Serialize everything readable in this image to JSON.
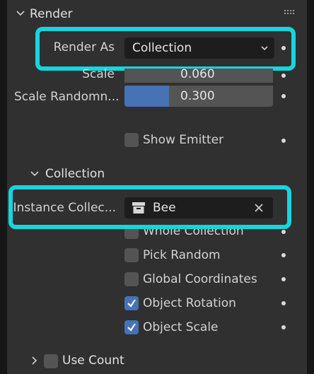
{
  "render_panel": {
    "title": "Render",
    "render_as": {
      "label": "Render As",
      "value": "Collection"
    },
    "scale": {
      "label": "Scale",
      "value": "0.060"
    },
    "scale_randomness": {
      "label": "Scale Randomn...",
      "value": "0.300",
      "fill_fraction": 0.3
    },
    "show_emitter": {
      "label": "Show Emitter",
      "checked": false
    }
  },
  "collection_panel": {
    "title": "Collection",
    "instance_collection": {
      "label": "Instance Collec...",
      "value": "Bee"
    },
    "whole_collection": {
      "label": "Whole Collection",
      "checked": false
    },
    "pick_random": {
      "label": "Pick Random",
      "checked": false
    },
    "global_coordinates": {
      "label": "Global Coordinates",
      "checked": false
    },
    "object_rotation": {
      "label": "Object Rotation",
      "checked": true
    },
    "object_scale": {
      "label": "Object Scale",
      "checked": true
    }
  },
  "use_count": {
    "label": "Use Count",
    "checked": false
  },
  "colors": {
    "highlight": "#16d5de",
    "accent": "#4772b3",
    "panel": "#303030"
  }
}
